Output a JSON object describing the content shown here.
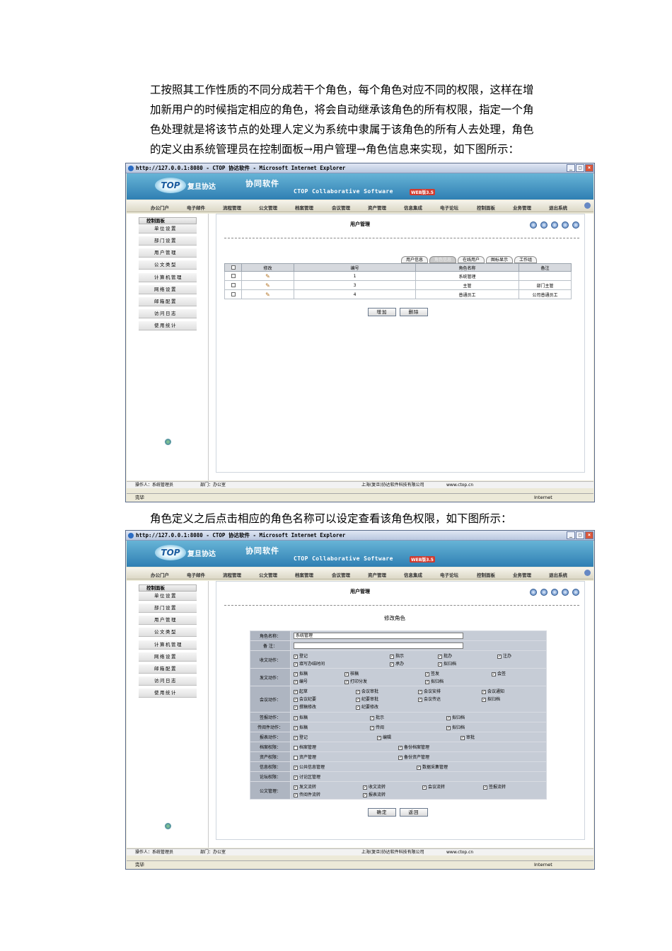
{
  "intro_lines": [
    "工按照其工作性质的不同分成若干个角色，每个角色对应不同的权限，这样在增",
    "加新用户的时候指定相应的角色，将会自动继承该角色的所有权限，指定一个角",
    "色处理就是将该节点的处理人定义为系统中隶属于该角色的所有人去处理，角色",
    "的定义由系统管理员在控制面板→用户管理→角色信息来实现，如下图所示："
  ],
  "middle_line": "角色定义之后点击相应的角色名称可以设定查看该角色权限，如下图所示：",
  "window": {
    "title": "http://127.0.0.1:8080 - CTOP 协达软件 - Microsoft Internet Explorer",
    "brand_logo": "TOP",
    "brand_company": "复旦协达",
    "brand_app": "协同软件",
    "brand_subtitle": "CTOP Collaborative Software",
    "brand_version": "WEB版3.5",
    "menu": [
      "办公门户",
      "电子邮件",
      "流程管理",
      "公文管理",
      "档案管理",
      "会议管理",
      "资产管理",
      "信息集成",
      "电子论坛",
      "控制面板",
      "业务管理",
      "退出系统"
    ],
    "side_title": "控制面板",
    "side_items": [
      "单位设置",
      "部门设置",
      "用户管理",
      "公文类型",
      "计算机管理",
      "网络设置",
      "邮箱配置",
      "访问日志",
      "使用统计"
    ],
    "page_title": "用户管理",
    "status_operator": "操作人：系统管理员",
    "status_dept": "部门：办公室",
    "status_company": "上海(复旦)协达软件科技有限公司",
    "status_site": "www.ctop.cn",
    "ie_status": "完毕",
    "ie_zone": "Internet"
  },
  "screen1": {
    "tabs": [
      "用户信息",
      "角色信息",
      "在线用户",
      "图标显示",
      "工作组"
    ],
    "columns": [
      "修改",
      "编号",
      "角色名称",
      "备注"
    ],
    "rows": [
      {
        "id": "1",
        "name": "系统管理",
        "note": ""
      },
      {
        "id": "3",
        "name": "主管",
        "note": "部门主管"
      },
      {
        "id": "4",
        "name": "普通员工",
        "note": "公司普通员工"
      }
    ],
    "add_button": "增加",
    "delete_button": "删除"
  },
  "screen2": {
    "form_title": "修改角色",
    "role_name_label": "角色名称：",
    "role_name_value": "系统管理",
    "note_label": "备 注：",
    "confirm_button": "确定",
    "back_button": "返回",
    "groups": [
      {
        "label": "收文动作：",
        "items": [
          [
            "登记",
            "指示",
            "批办",
            "注办"
          ],
          [
            "填写办结时间",
            "承办",
            "拟归档"
          ]
        ]
      },
      {
        "label": "发文动作：",
        "items": [
          [
            "拟稿",
            "核稿",
            "签发",
            "会签"
          ],
          [
            "编号",
            "打印分发",
            "拟归档"
          ]
        ]
      },
      {
        "label": "会议动作：",
        "items": [
          [
            "起草",
            "会议审批",
            "会议安排",
            "会议通知"
          ],
          [
            "会议纪要",
            "纪要审批",
            "会议传达",
            "拟归档"
          ],
          [
            "撰稿修改",
            "纪要修改"
          ]
        ]
      },
      {
        "label": "签报动作：",
        "items": [
          [
            "拟稿",
            "批示",
            "拟归档"
          ]
        ]
      },
      {
        "label": "传阅件动作：",
        "items": [
          [
            "拟稿",
            "传阅",
            "拟归档"
          ]
        ]
      },
      {
        "label": "报表动作：",
        "items": [
          [
            "登记",
            "编辑",
            "审批"
          ]
        ]
      },
      {
        "label": "档案权限：",
        "items": [
          [
            "档案管理",
            "备份档案管理"
          ]
        ]
      },
      {
        "label": "资产权限：",
        "items": [
          [
            "资产管理",
            "备份资产管理"
          ]
        ]
      },
      {
        "label": "信息权限：",
        "items": [
          [
            "公共信息管理",
            "数据采集管理"
          ]
        ]
      },
      {
        "label": "论坛权限：",
        "items": [
          [
            "讨论区管理"
          ]
        ]
      },
      {
        "label": "公文管理：",
        "items": [
          [
            "发文流转",
            "收文流转",
            "会议流转",
            "签报流转"
          ],
          [
            "传阅件流转",
            "报表流转"
          ]
        ]
      }
    ]
  }
}
